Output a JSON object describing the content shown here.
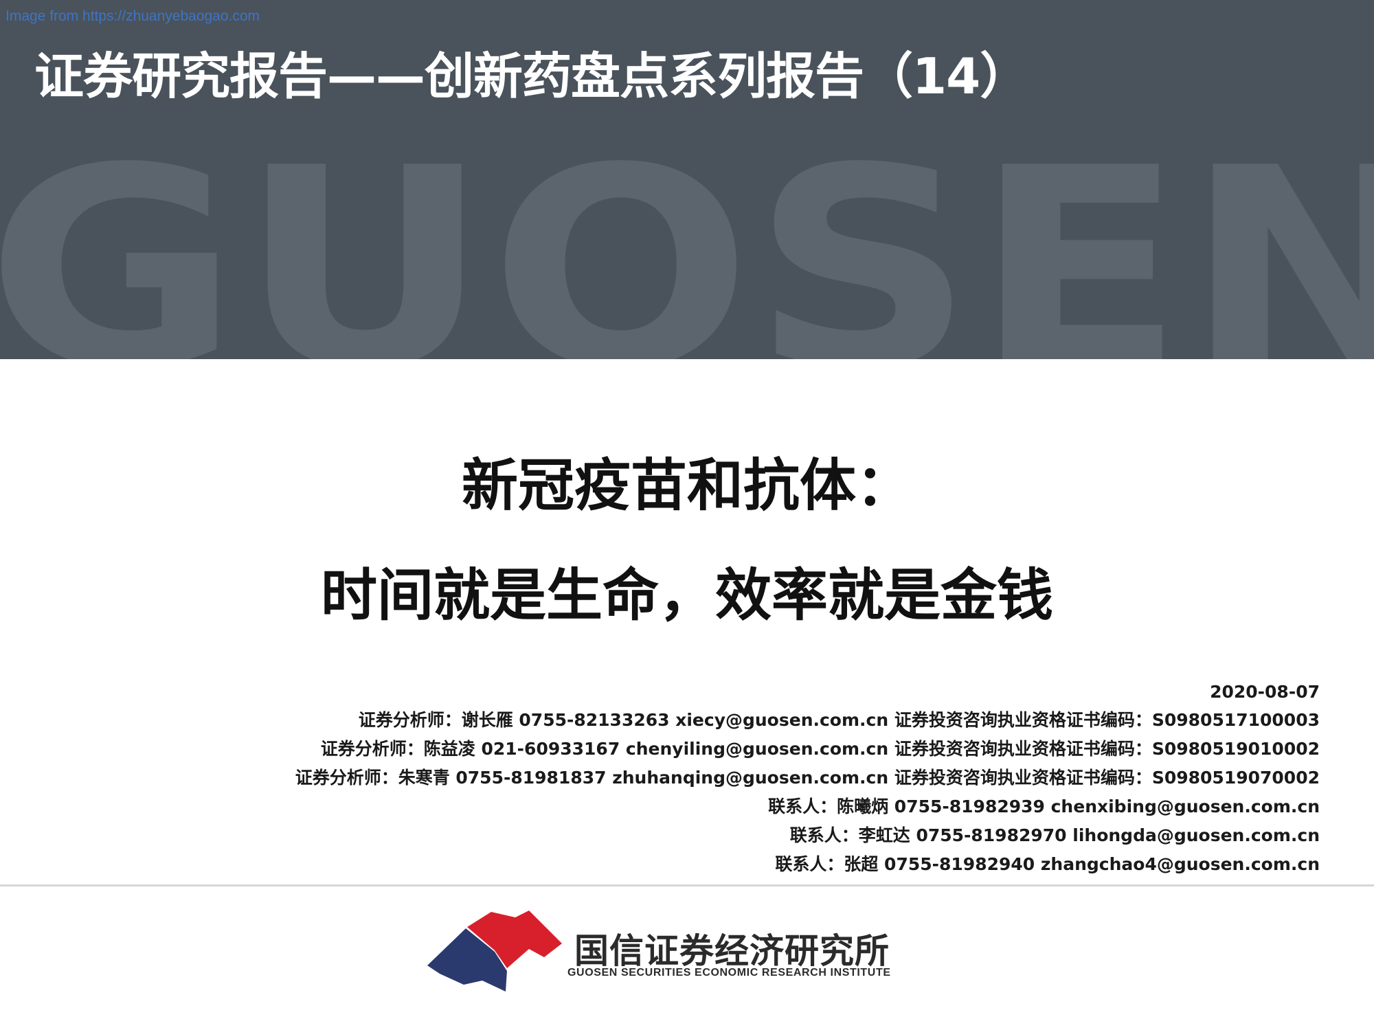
{
  "header": {
    "watermark_url": "Image from https://zhuanyebaogao.com",
    "report_series": "证券研究报告——创新药盘点系列报告（14）",
    "brand_watermark": "GUOSEN"
  },
  "title": {
    "line1": "新冠疫苗和抗体：",
    "line2": "时间就是生命，效率就是金钱"
  },
  "meta": {
    "date": "2020-08-07",
    "analysts": [
      "证券分析师：谢长雁 0755-82133263 xiecy@guosen.com.cn 证券投资咨询执业资格证书编码：S0980517100003",
      "证券分析师：陈益凌 021-60933167 chenyiling@guosen.com.cn 证券投资咨询执业资格证书编码：S0980519010002",
      "证券分析师：朱寒青 0755-81981837 zhuhanqing@guosen.com.cn 证券投资咨询执业资格证书编码：S0980519070002"
    ],
    "contacts": [
      "联系人：陈曦炳 0755-81982939 chenxibing@guosen.com.cn",
      "联系人：李虹达 0755-81982970 lihongda@guosen.com.cn",
      "联系人：张超 0755-81982940 zhangchao4@guosen.com.cn"
    ]
  },
  "logo": {
    "name_cn": "国信证券经济研究所",
    "name_en": "GUOSEN SECURITIES ECONOMIC RESEARCH INSTITUTE"
  },
  "colors": {
    "banner": "#4a535b",
    "watermark": "#5c656d",
    "logo_red": "#d7202c",
    "logo_blue": "#2b3a6e"
  }
}
